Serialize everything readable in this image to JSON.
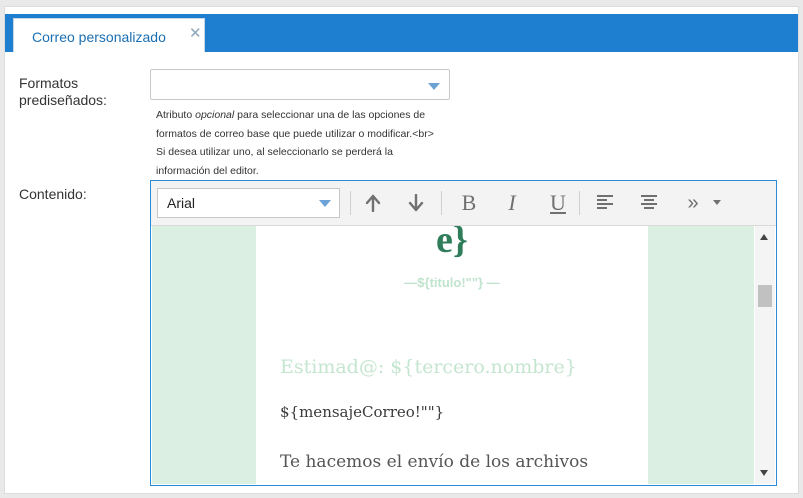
{
  "tab": {
    "label": "Correo personalizado",
    "close_glyph": "✕"
  },
  "form": {
    "formatos_label_line1": "Formatos",
    "formatos_label_line2": "prediseñados:",
    "formatos_value": "",
    "help_line1_a": "Atributo ",
    "help_line1_b": "opcional",
    "help_line1_c": " para seleccionar una de las opciones de",
    "help_line2": "formatos de correo base que puede utilizar o modificar.<br>",
    "help_line3": "Si desea utilizar uno, al seleccionarlo se perderá la",
    "help_line4": "información del editor.",
    "contenido_label": "Contenido:"
  },
  "toolbar": {
    "font_value": "Arial",
    "bold_glyph": "B",
    "italic_glyph": "I",
    "underline_glyph": "U",
    "more_glyph": "»",
    "icons": [
      "arrow-up-icon",
      "arrow-down-icon",
      "bold-icon",
      "italic-icon",
      "underline-icon",
      "align-left-icon",
      "align-center-icon",
      "more-icon",
      "chevron-down-icon"
    ]
  },
  "content": {
    "logo": "e}",
    "titulo": "—${titulo!\"\"} —",
    "estimado": "Estimad@: ${tercero.nombre}",
    "mensaje": "${mensajeCorreo!\"\"}",
    "envio": "Te hacemos el envío de los archivos"
  },
  "colors": {
    "tab_bar": "#1e7fd0",
    "editor_border": "#2a8ad6",
    "side_green": "#dcefe3",
    "logo_green": "#2f7d5a"
  }
}
